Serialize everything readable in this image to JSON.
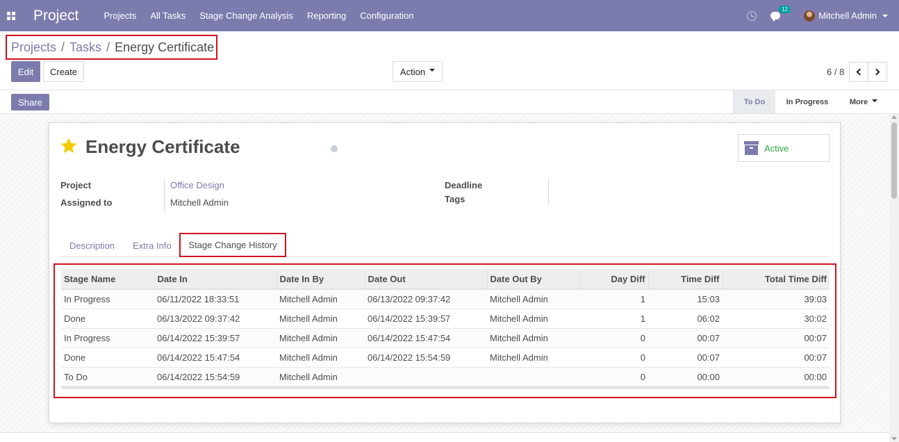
{
  "navbar": {
    "brand": "Project",
    "menu": [
      "Projects",
      "All Tasks",
      "Stage Change Analysis",
      "Reporting",
      "Configuration"
    ],
    "message_count": "12",
    "user": "Mitchell Admin"
  },
  "breadcrumb": {
    "items": [
      "Projects",
      "Tasks"
    ],
    "separator": "/",
    "current": "Energy Certificate"
  },
  "toolbar": {
    "edit": "Edit",
    "create": "Create",
    "action": "Action",
    "pager": "6 / 8"
  },
  "statusbar": {
    "share": "Share",
    "stages": [
      "To Do",
      "In Progress"
    ],
    "more": "More",
    "current_stage": "To Do"
  },
  "task": {
    "title": "Energy Certificate",
    "starred": true,
    "active_label": "Active",
    "fields": {
      "project_label": "Project",
      "project_value": "Office Design",
      "assigned_label": "Assigned to",
      "assigned_value": "Mitchell Admin",
      "deadline_label": "Deadline",
      "tags_label": "Tags"
    }
  },
  "tabs": {
    "description": "Description",
    "extra_info": "Extra Info",
    "stage_history": "Stage Change History",
    "active": "Stage Change History"
  },
  "history_table": {
    "headers": [
      "Stage Name",
      "Date In",
      "Date In By",
      "Date Out",
      "Date Out By",
      "Day Diff",
      "Time Diff",
      "Total Time Diff"
    ],
    "rows": [
      [
        "In Progress",
        "06/11/2022 18:33:51",
        "Mitchell Admin",
        "06/13/2022 09:37:42",
        "Mitchell Admin",
        "1",
        "15:03",
        "39:03"
      ],
      [
        "Done",
        "06/13/2022 09:37:42",
        "Mitchell Admin",
        "06/14/2022 15:39:57",
        "Mitchell Admin",
        "1",
        "06:02",
        "30:02"
      ],
      [
        "In Progress",
        "06/14/2022 15:39:57",
        "Mitchell Admin",
        "06/14/2022 15:47:54",
        "Mitchell Admin",
        "0",
        "00:07",
        "00:07"
      ],
      [
        "Done",
        "06/14/2022 15:47:54",
        "Mitchell Admin",
        "06/14/2022 15:54:59",
        "Mitchell Admin",
        "0",
        "00:07",
        "00:07"
      ],
      [
        "To Do",
        "06/14/2022 15:54:59",
        "Mitchell Admin",
        "",
        "",
        "0",
        "00:00",
        "00:00"
      ]
    ]
  },
  "colors": {
    "brand": "#7c7bad",
    "highlight_border": "#d0121e",
    "active_green": "#28a745",
    "star": "#f3cc00"
  }
}
